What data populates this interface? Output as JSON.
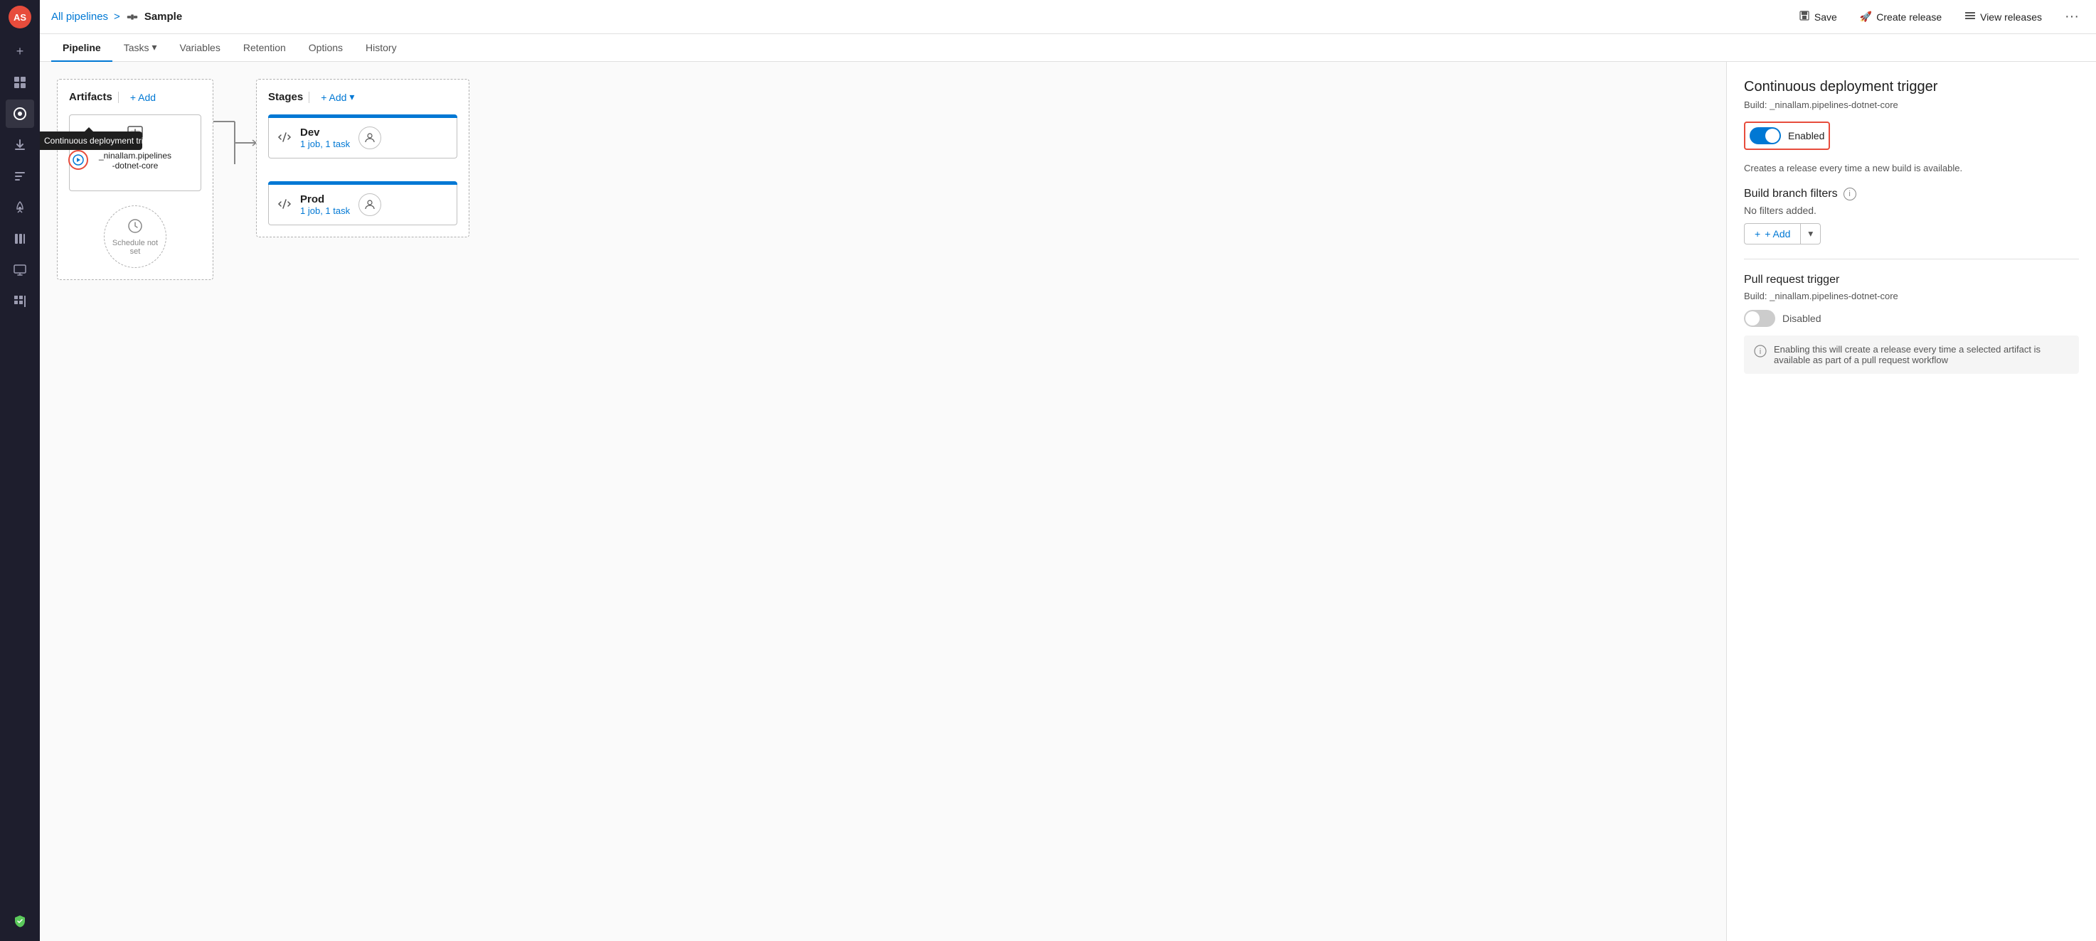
{
  "app": {
    "avatar_initials": "AS"
  },
  "sidebar": {
    "icons": [
      {
        "name": "plus-icon",
        "symbol": "+",
        "active": false
      },
      {
        "name": "dashboard-icon",
        "symbol": "⊟",
        "active": false
      },
      {
        "name": "pipeline-icon",
        "symbol": "◈",
        "active": true
      },
      {
        "name": "deploy-icon",
        "symbol": "⬆",
        "active": false
      },
      {
        "name": "test-icon",
        "symbol": "☰",
        "active": false
      },
      {
        "name": "rocket-icon",
        "symbol": "🚀",
        "active": false
      },
      {
        "name": "library-icon",
        "symbol": "⊞",
        "active": false
      },
      {
        "name": "monitor-icon",
        "symbol": "▤",
        "active": false
      },
      {
        "name": "grid-icon",
        "symbol": "⊞",
        "active": false
      },
      {
        "name": "shield-icon",
        "symbol": "⛨",
        "active": false,
        "green": true
      }
    ]
  },
  "topbar": {
    "breadcrumb_link": "All pipelines",
    "breadcrumb_sep": ">",
    "pipeline_name": "Sample",
    "save_label": "Save",
    "create_release_label": "Create release",
    "view_releases_label": "View releases"
  },
  "nav_tabs": [
    {
      "label": "Pipeline",
      "active": true
    },
    {
      "label": "Tasks",
      "has_arrow": true,
      "active": false
    },
    {
      "label": "Variables",
      "active": false
    },
    {
      "label": "Retention",
      "active": false
    },
    {
      "label": "Options",
      "active": false
    },
    {
      "label": "History",
      "active": false
    }
  ],
  "pipeline": {
    "artifacts_label": "Artifacts",
    "add_label": "+ Add",
    "stages_label": "Stages",
    "stages_add_label": "+ Add",
    "artifact": {
      "icon": "📥",
      "name": "_ninallam.pipelines\n-dotnet-core"
    },
    "trigger_tooltip": "Continuous deployment trigger",
    "schedule_label": "Schedule not set",
    "stages": [
      {
        "name": "Dev",
        "detail": "1 job, 1 task"
      },
      {
        "name": "Prod",
        "detail": "1 job, 1 task"
      }
    ]
  },
  "right_panel": {
    "title": "Continuous deployment trigger",
    "subtitle": "Build: _ninallam.pipelines-dotnet-core",
    "toggle_enabled": true,
    "toggle_label": "Enabled",
    "toggle_help": "Creates a release every time a new build is available.",
    "build_branch_filters_label": "Build branch filters",
    "no_filters_text": "No filters added.",
    "add_label": "+ Add",
    "pr_trigger_title": "Pull request trigger",
    "pr_subtitle": "Build: _ninallam.pipelines-dotnet-core",
    "pr_toggle_enabled": false,
    "pr_toggle_label": "Disabled",
    "pr_info_text": "Enabling this will create a release every time a selected artifact is available as part of a pull request workflow"
  }
}
